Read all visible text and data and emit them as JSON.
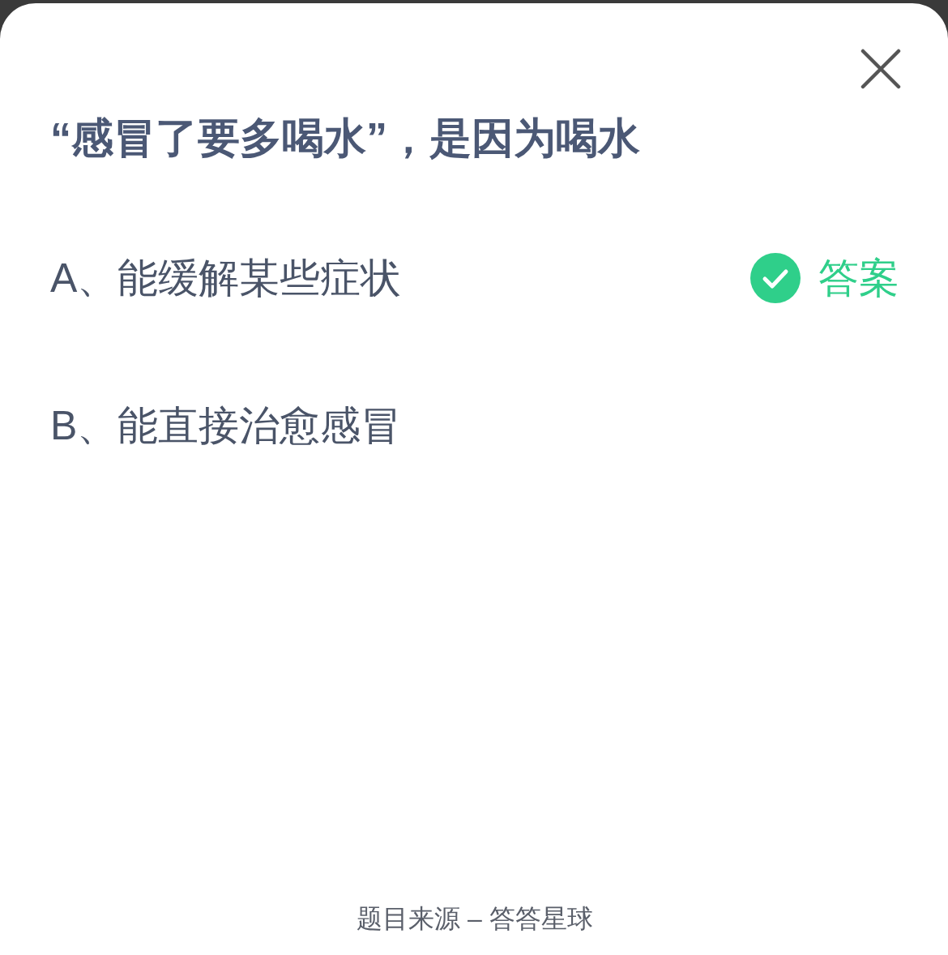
{
  "question": {
    "title": "“感冒了要多喝水”，是因为喝水"
  },
  "options": [
    {
      "text": "A、能缓解某些症状",
      "correct": true
    },
    {
      "text": "B、能直接治愈感冒",
      "correct": false
    }
  ],
  "answer_tag": "答案",
  "footer": "题目来源 – 答答星球"
}
